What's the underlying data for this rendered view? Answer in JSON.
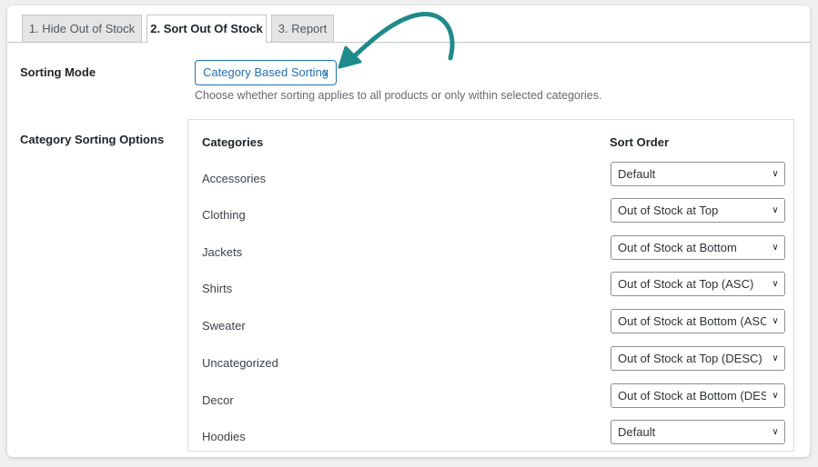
{
  "tabs": [
    {
      "label": "1. Hide Out of Stock"
    },
    {
      "label": "2. Sort Out Of Stock"
    },
    {
      "label": "3. Report"
    }
  ],
  "sorting_mode": {
    "label": "Sorting Mode",
    "selected": "Category Based Sorting",
    "description": "Choose whether sorting applies to all products or only within selected categories."
  },
  "category_options": {
    "label": "Category Sorting Options",
    "headers": {
      "categories": "Categories",
      "sort_order": "Sort Order"
    },
    "rows": [
      {
        "category": "Accessories",
        "order": "Default"
      },
      {
        "category": "Clothing",
        "order": "Out of Stock at Top"
      },
      {
        "category": "Jackets",
        "order": "Out of Stock at Bottom"
      },
      {
        "category": "Shirts",
        "order": "Out of Stock at Top (ASC)"
      },
      {
        "category": "Sweater",
        "order": "Out of Stock at Bottom (ASC)"
      },
      {
        "category": "Uncategorized",
        "order": "Out of Stock at Top (DESC)"
      },
      {
        "category": "Decor",
        "order": "Out of Stock at Bottom (DESC)"
      },
      {
        "category": "Hoodies",
        "order": "Default"
      }
    ]
  },
  "colors": {
    "accent": "#2271b1",
    "arrow": "#1f8a8a"
  },
  "icons": {
    "dropdown": "chevron-down-icon",
    "annotation": "curved-arrow-icon"
  }
}
